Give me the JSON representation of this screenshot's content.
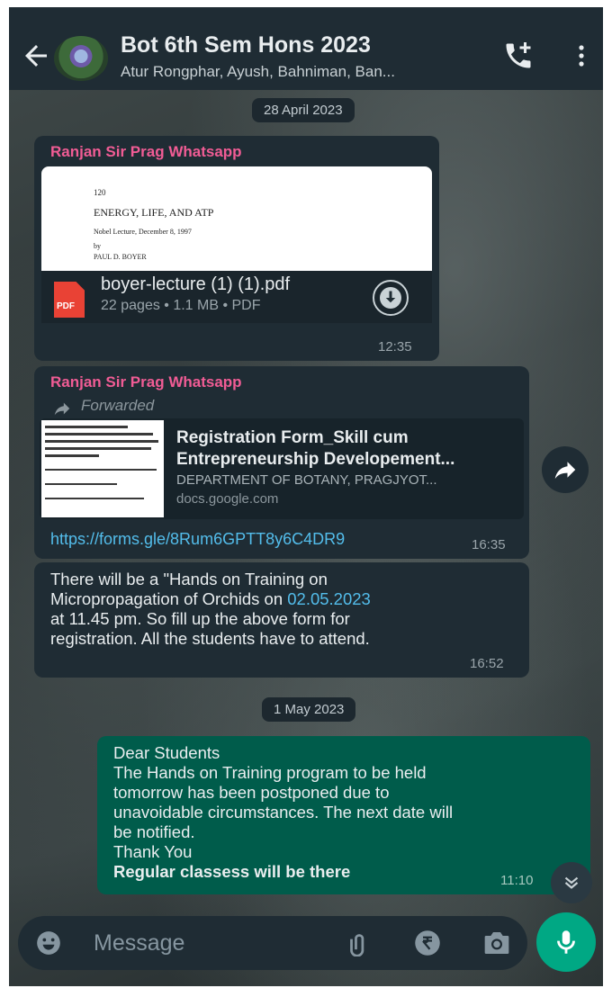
{
  "header": {
    "title": "Bot 6th Sem Hons 2023",
    "subtitle": "Atur Rongphar, Ayush, Bahniman, Ban..."
  },
  "dates": [
    "28 April 2023",
    "1 May 2023"
  ],
  "messages": [
    {
      "sender": "Ranjan Sir Prag Whatsapp",
      "doc_preview_lines": [
        "120",
        "ENERGY, LIFE, AND ATP",
        "Nobel Lecture, December 8, 1997",
        "by",
        "PAUL D. BOYER"
      ],
      "file_name": "boyer-lecture (1) (1).pdf",
      "file_meta": "22 pages • 1.1 MB • PDF",
      "file_icon_label": "PDF",
      "time": "12:35"
    },
    {
      "sender": "Ranjan Sir Prag Whatsapp",
      "forwarded_label": "Forwarded",
      "link_title_1": "Registration Form_Skill cum",
      "link_title_2": "Entrepreneurship Developement...",
      "link_desc": "DEPARTMENT OF BOTANY, PRAGJYOT...",
      "link_domain": "docs.google.com",
      "link_url": "https://forms.gle/8Rum6GPTT8y6C4DR9",
      "time": "16:35"
    },
    {
      "line1": "There will be a \"Hands on Training on",
      "line2_a": "Micropropagation of Orchids on ",
      "line2_date": "02.05.2023",
      "line3": "at 11.45 pm. So fill up the above form for",
      "line4": "registration. All the students have to attend.",
      "time": "16:52"
    },
    {
      "lines": [
        "Dear Students",
        "The Hands on Training program to be held",
        "tomorrow has been postponed due to",
        "unavoidable circumstances. The next date will",
        "be notified.",
        "Thank You"
      ],
      "bold_line": "Regular classess will be there",
      "time": "11:10"
    }
  ],
  "input": {
    "placeholder": "Message"
  },
  "colors": {
    "accent": "#00a884",
    "sender": "#f15c95",
    "link": "#53bdeb",
    "outgoing": "#005c4b"
  }
}
